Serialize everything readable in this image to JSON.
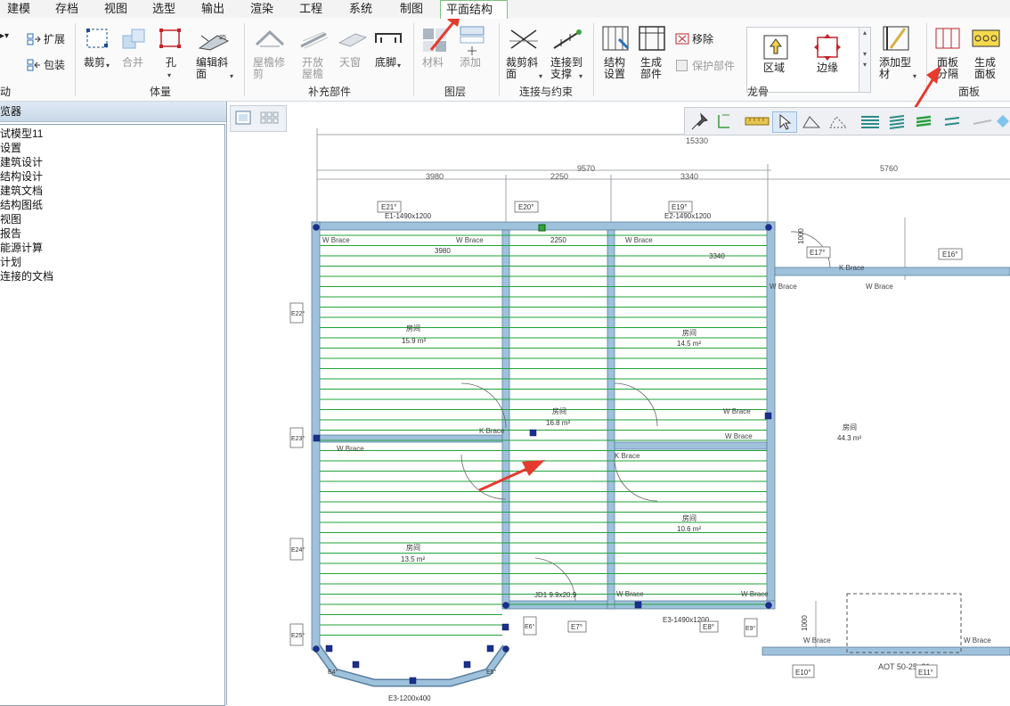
{
  "menu": {
    "tabs": [
      "建模",
      "存档",
      "视图",
      "选型",
      "输出",
      "渲染",
      "工程",
      "系统",
      "制图",
      "平面结构"
    ],
    "active": "平面结构"
  },
  "ribbon": {
    "left_buttons": {
      "expand": "扩展",
      "wrap": "包装",
      "auto_group_partial": "动"
    },
    "volume": {
      "label": "体量",
      "cut": "裁剪",
      "merge": "合并",
      "hole": "孔",
      "edit_slope_1": "编辑斜",
      "edit_slope_2": "面"
    },
    "supplement": {
      "label": "补充部件",
      "eave_trim_1": "屋檐修",
      "eave_trim_2": "剪",
      "open_eave_1": "开放",
      "open_eave_2": "屋檐",
      "skylight": "天窗",
      "baseboard": "底脚"
    },
    "layer": {
      "label": "图层",
      "material": "材料",
      "add": "添加"
    },
    "connection": {
      "label": "连接与约束",
      "cut_slope_1": "裁剪斜",
      "cut_slope_2": "面",
      "connect_to_1": "连接到",
      "connect_to_2": "支撑"
    },
    "keel": {
      "label": "龙骨",
      "struct_setup_1": "结构",
      "struct_setup_2": "设置",
      "gen_parts_1": "生成",
      "gen_parts_2": "部件",
      "remove": "移除",
      "protect": "保护部件",
      "region": "区域",
      "edge": "边缘",
      "add_profile_1": "添加型",
      "add_profile_2": "材"
    },
    "panel": {
      "label": "面板",
      "panel_split_1": "面板",
      "panel_split_2": "分隔",
      "gen_panel_1": "生成",
      "gen_panel_2": "面板"
    }
  },
  "tree": {
    "header": "览器",
    "items": [
      "试模型11",
      "设置",
      "建筑设计",
      "结构设计",
      "建筑文档",
      "结构图纸",
      "视图",
      "报告",
      "能源计算",
      "计划",
      "连接的文档"
    ]
  },
  "drawing": {
    "dims": {
      "total": "15330",
      "mid": "9570",
      "d1": "3980",
      "d2": "2250",
      "d3": "3340",
      "d4": "5760",
      "i1": "3980",
      "i2": "2250",
      "i3": "3340",
      "v1": "1000",
      "v2": "1000"
    },
    "rooms": [
      {
        "name": "房间",
        "area": "15.9 m²"
      },
      {
        "name": "房间",
        "area": "14.5 m²"
      },
      {
        "name": "房间",
        "area": "16.8 m²"
      },
      {
        "name": "房间",
        "area": "44.3 m²"
      },
      {
        "name": "房间",
        "area": "10.6 m²"
      },
      {
        "name": "房间",
        "area": "13.5 m²"
      }
    ],
    "tags": {
      "e21": "E21°",
      "e20": "E20°",
      "e19": "E19°",
      "e17": "E17°",
      "e16": "E16°",
      "e22": "E22°",
      "e23": "E23°",
      "e24": "E24°",
      "e25": "E25°",
      "e3": "E3-1490x1200",
      "e2": "E2-1490x1200",
      "e1": "E1-1490x1200",
      "e3b": "E3-1200x400",
      "e10": "E10°",
      "e11": "E11°",
      "e8": "E8°",
      "e7": "E7°",
      "e9": "E9°",
      "e6": "E6°",
      "e4": "E4°",
      "e5": "E5°",
      "jd1": "JD1 9.9x20.9",
      "aot": "AOT 50-25x21"
    },
    "wall_text": {
      "w": "W Brace",
      "k": "K Brace"
    }
  }
}
